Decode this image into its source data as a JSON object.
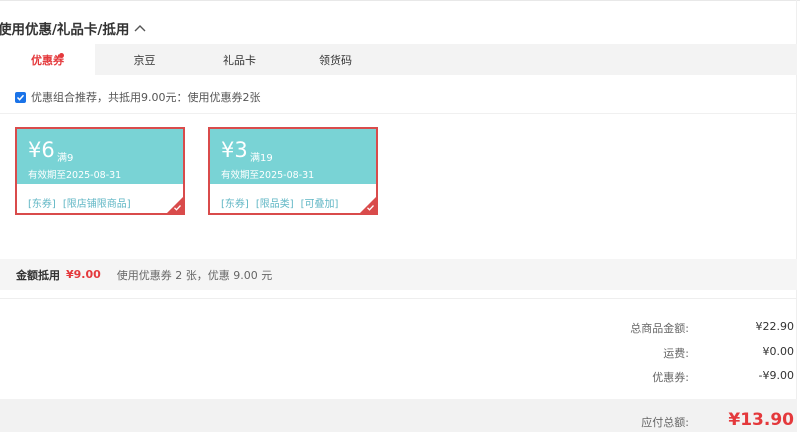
{
  "section": {
    "title": "使用优惠/礼品卡/抵用"
  },
  "tabs": [
    {
      "label": "优惠券"
    },
    {
      "label": "京豆"
    },
    {
      "label": "礼品卡"
    },
    {
      "label": "领货码"
    }
  ],
  "recommend": {
    "checked": true,
    "text": "优惠组合推荐，共抵用9.00元：使用优惠券2张"
  },
  "coupons": [
    {
      "amount": "¥6",
      "condition": "满9",
      "valid": "有效期至2025-08-31",
      "tags": [
        "[东券]",
        "[限店铺限商品]"
      ],
      "selected": true
    },
    {
      "amount": "¥3",
      "condition": "满19",
      "valid": "有效期至2025-08-31",
      "tags": [
        "[东券]",
        "[限品类]",
        "[可叠加]"
      ],
      "selected": true
    }
  ],
  "summary": {
    "label": "金额抵用",
    "amount": "¥9.00",
    "desc": "使用优惠券 2 张，优惠 9.00 元"
  },
  "totals": {
    "goods_label": "总商品金额:",
    "goods_value": "¥22.90",
    "shipping_label": "运费:",
    "shipping_value": "¥0.00",
    "coupon_label": "优惠券:",
    "coupon_value": "-¥9.00",
    "payable_label": "应付总额:",
    "payable_value": "¥13.90"
  },
  "colors": {
    "accent": "#e4393c",
    "coupon_bg": "#79d3d5",
    "coupon_border": "#d94b4b",
    "tag_text": "#5fb6c4"
  }
}
